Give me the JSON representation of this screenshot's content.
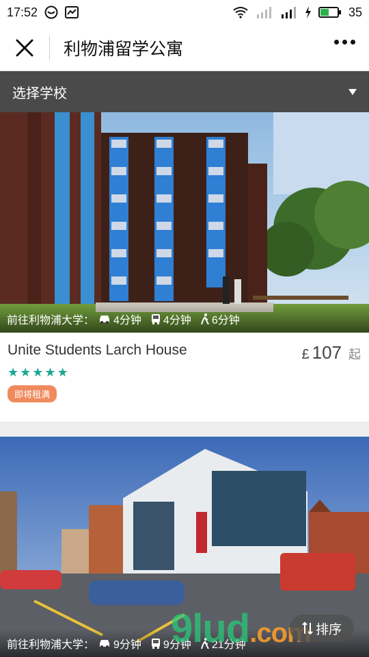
{
  "status": {
    "time": "17:52",
    "battery": "35"
  },
  "nav": {
    "title": "利物浦留学公寓"
  },
  "filter": {
    "label": "选择学校"
  },
  "listings": [
    {
      "route_label": "前往利物浦大学：",
      "car_time": "4分钟",
      "bus_time": "4分钟",
      "walk_time": "6分钟",
      "name": "Unite Students Larch House",
      "currency": "£",
      "price": "107",
      "price_suffix": "起",
      "rating": 5,
      "badge": "即将租满"
    },
    {
      "route_label": "前往利物浦大学：",
      "car_time": "9分钟",
      "bus_time": "9分钟",
      "walk_time": "21分钟"
    }
  ],
  "sort": {
    "label": "排序"
  },
  "watermark": {
    "main": "9lud",
    "sub": ".com"
  },
  "colors": {
    "accent_green": "#1aa88f",
    "badge_orange": "#f08a5d",
    "filter_bg": "#4a4a4a"
  }
}
